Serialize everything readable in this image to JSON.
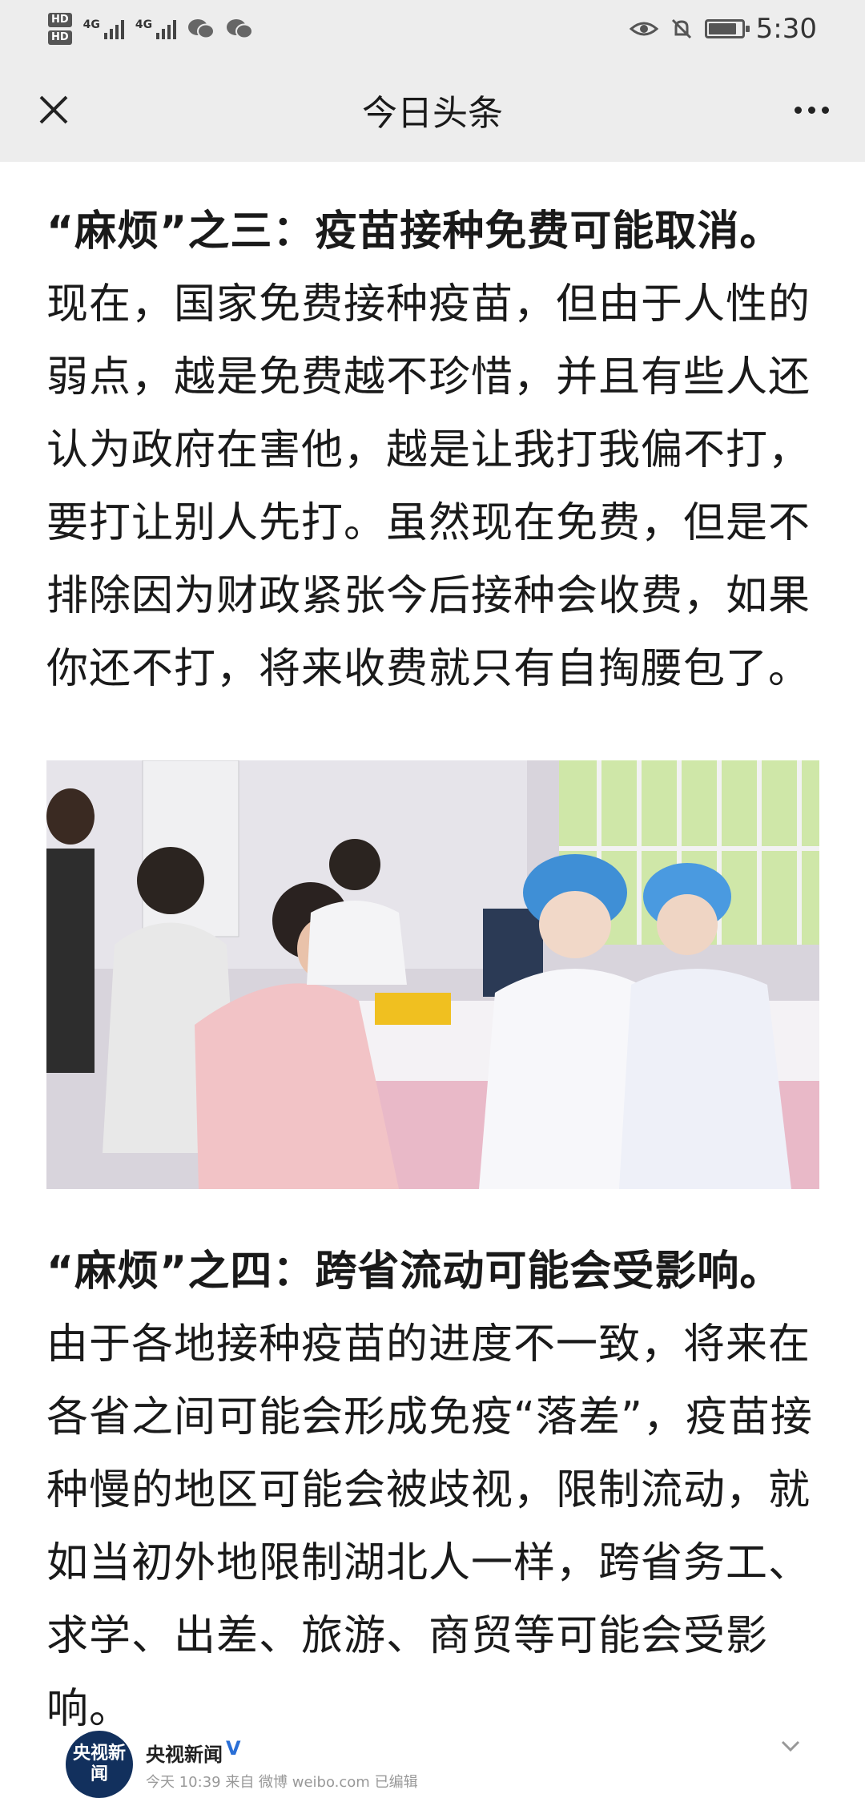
{
  "status_bar": {
    "hd1": "HD",
    "hd2": "HD",
    "net1": "4G",
    "net2": "4G",
    "time": "5:30",
    "battery_level": 0.85
  },
  "nav": {
    "title": "今日头条"
  },
  "article": {
    "para3_heading": "“麻烦”之三：疫苗接种免费可能取消。",
    "para3_body": "现在，国家免费接种疫苗，但由于人性的弱点，越是免费越不珍惜，并且有些人还认为政府在害他，越是让我打我偏不打，要打让别人先打。虽然现在免费，但是不排除因为财政紧张今后接种会收费，如果你还不打，将来收费就只有自掏腰包了。",
    "para4_heading": "“麻烦”之四：跨省流动可能会受影响。",
    "para4_body": "由于各地接种疫苗的进度不一致，将来在各省之间可能会形成免疫“落差”，疫苗接种慢的地区可能会被歧视，限制流动，就如当初外地限制湖北人一样，跨省务工、求学、出差、旅游、商贸等可能会受影响。"
  },
  "weibo": {
    "avatar_text": "央视新闻",
    "name": "央视新闻",
    "meta": "今天 10:39 来自 微博 weibo.com   已编辑"
  },
  "colors": {
    "bar_bg": "#ededed",
    "accent_verified": "#2a6fd6",
    "avatar_bg": "#12305d"
  },
  "icons": [
    "close-icon",
    "more-icon",
    "eye-icon",
    "mute-bell-icon",
    "battery-icon",
    "wechat-icon",
    "chevron-down-icon"
  ]
}
